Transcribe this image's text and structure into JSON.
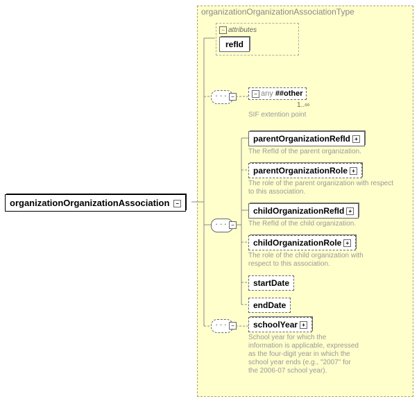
{
  "typeName": "organizationOrganizationAssociationType",
  "root": "organizationOrganizationAssociation",
  "attrs": {
    "label": "attributes",
    "refId": "refId"
  },
  "any": {
    "any": "any",
    "other": "##other",
    "card": "1..∞",
    "desc": "SIF extention point"
  },
  "e1": {
    "name": "parentOrganizationRefId",
    "desc": "The RefId of the parent organization."
  },
  "e2": {
    "name": "parentOrganizationRole",
    "desc": "The role of the parent organization with respect to this association."
  },
  "e3": {
    "name": "childOrganizationRefId",
    "desc": "The RefId of the child organization."
  },
  "e4": {
    "name": "childOrganizationRole",
    "desc": "The role of the child organization with respect to this association."
  },
  "e5": {
    "name": "startDate"
  },
  "e6": {
    "name": "endDate"
  },
  "e7": {
    "name": "schoolYear",
    "desc": "School year for which the information is applicable, expressed as the four-digit year in which the school year ends (e.g., \"2007\" for the 2006-07 school year)."
  }
}
